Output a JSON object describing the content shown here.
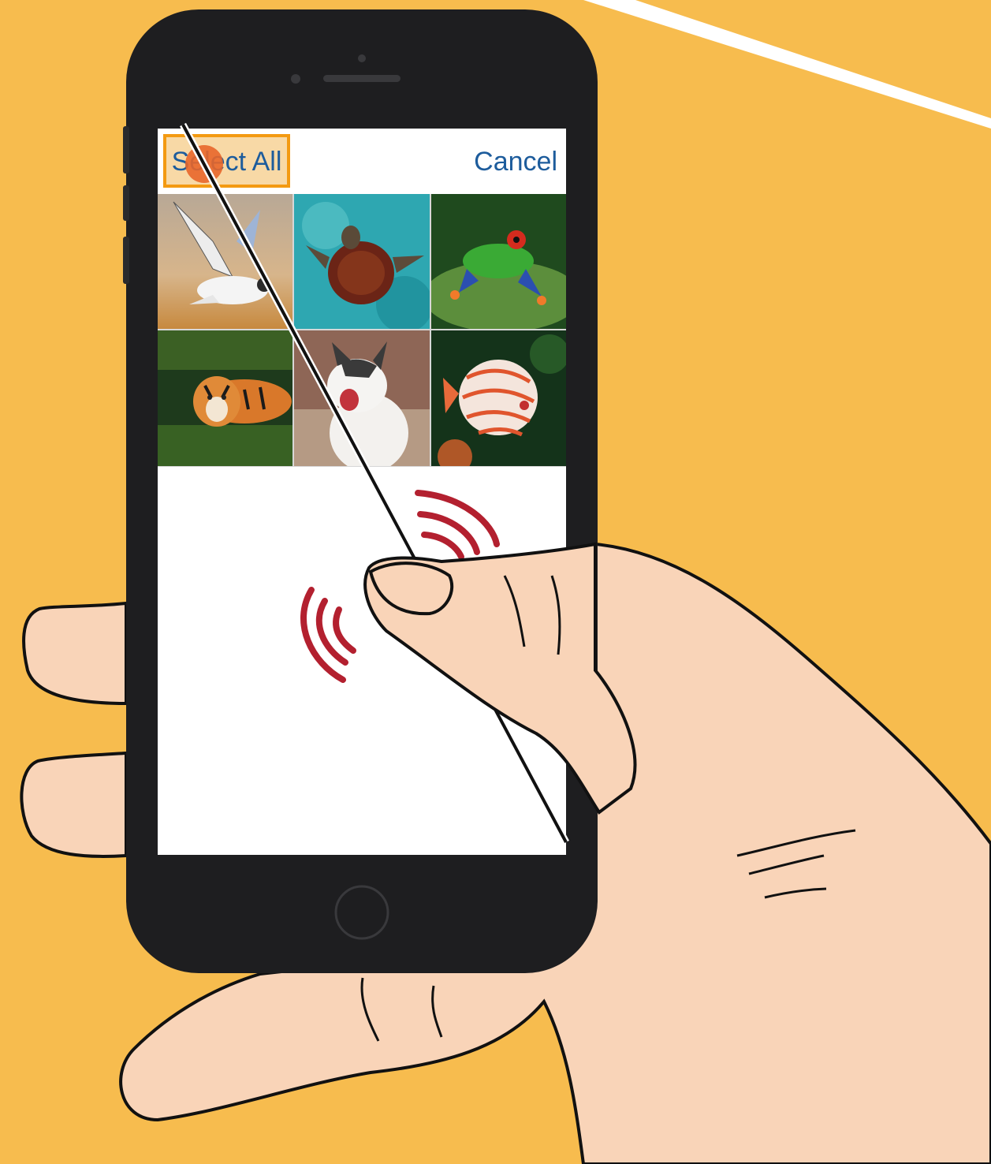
{
  "nav": {
    "select_all_label": "Select All",
    "cancel_label": "Cancel"
  },
  "photos": [
    {
      "subject": "seagull"
    },
    {
      "subject": "sea turtle"
    },
    {
      "subject": "tree frog"
    },
    {
      "subject": "tiger"
    },
    {
      "subject": "kitten"
    },
    {
      "subject": "discus fish"
    }
  ],
  "colors": {
    "background": "#F7BC4E",
    "phone_body": "#1E1E20",
    "link_blue": "#1D5C9C",
    "highlight_border": "#F39A12",
    "highlight_fill": "#F8D9A6",
    "touch_dot": "#E8662B",
    "vibration": "#B3202F",
    "skin": "#F9D4B8"
  }
}
